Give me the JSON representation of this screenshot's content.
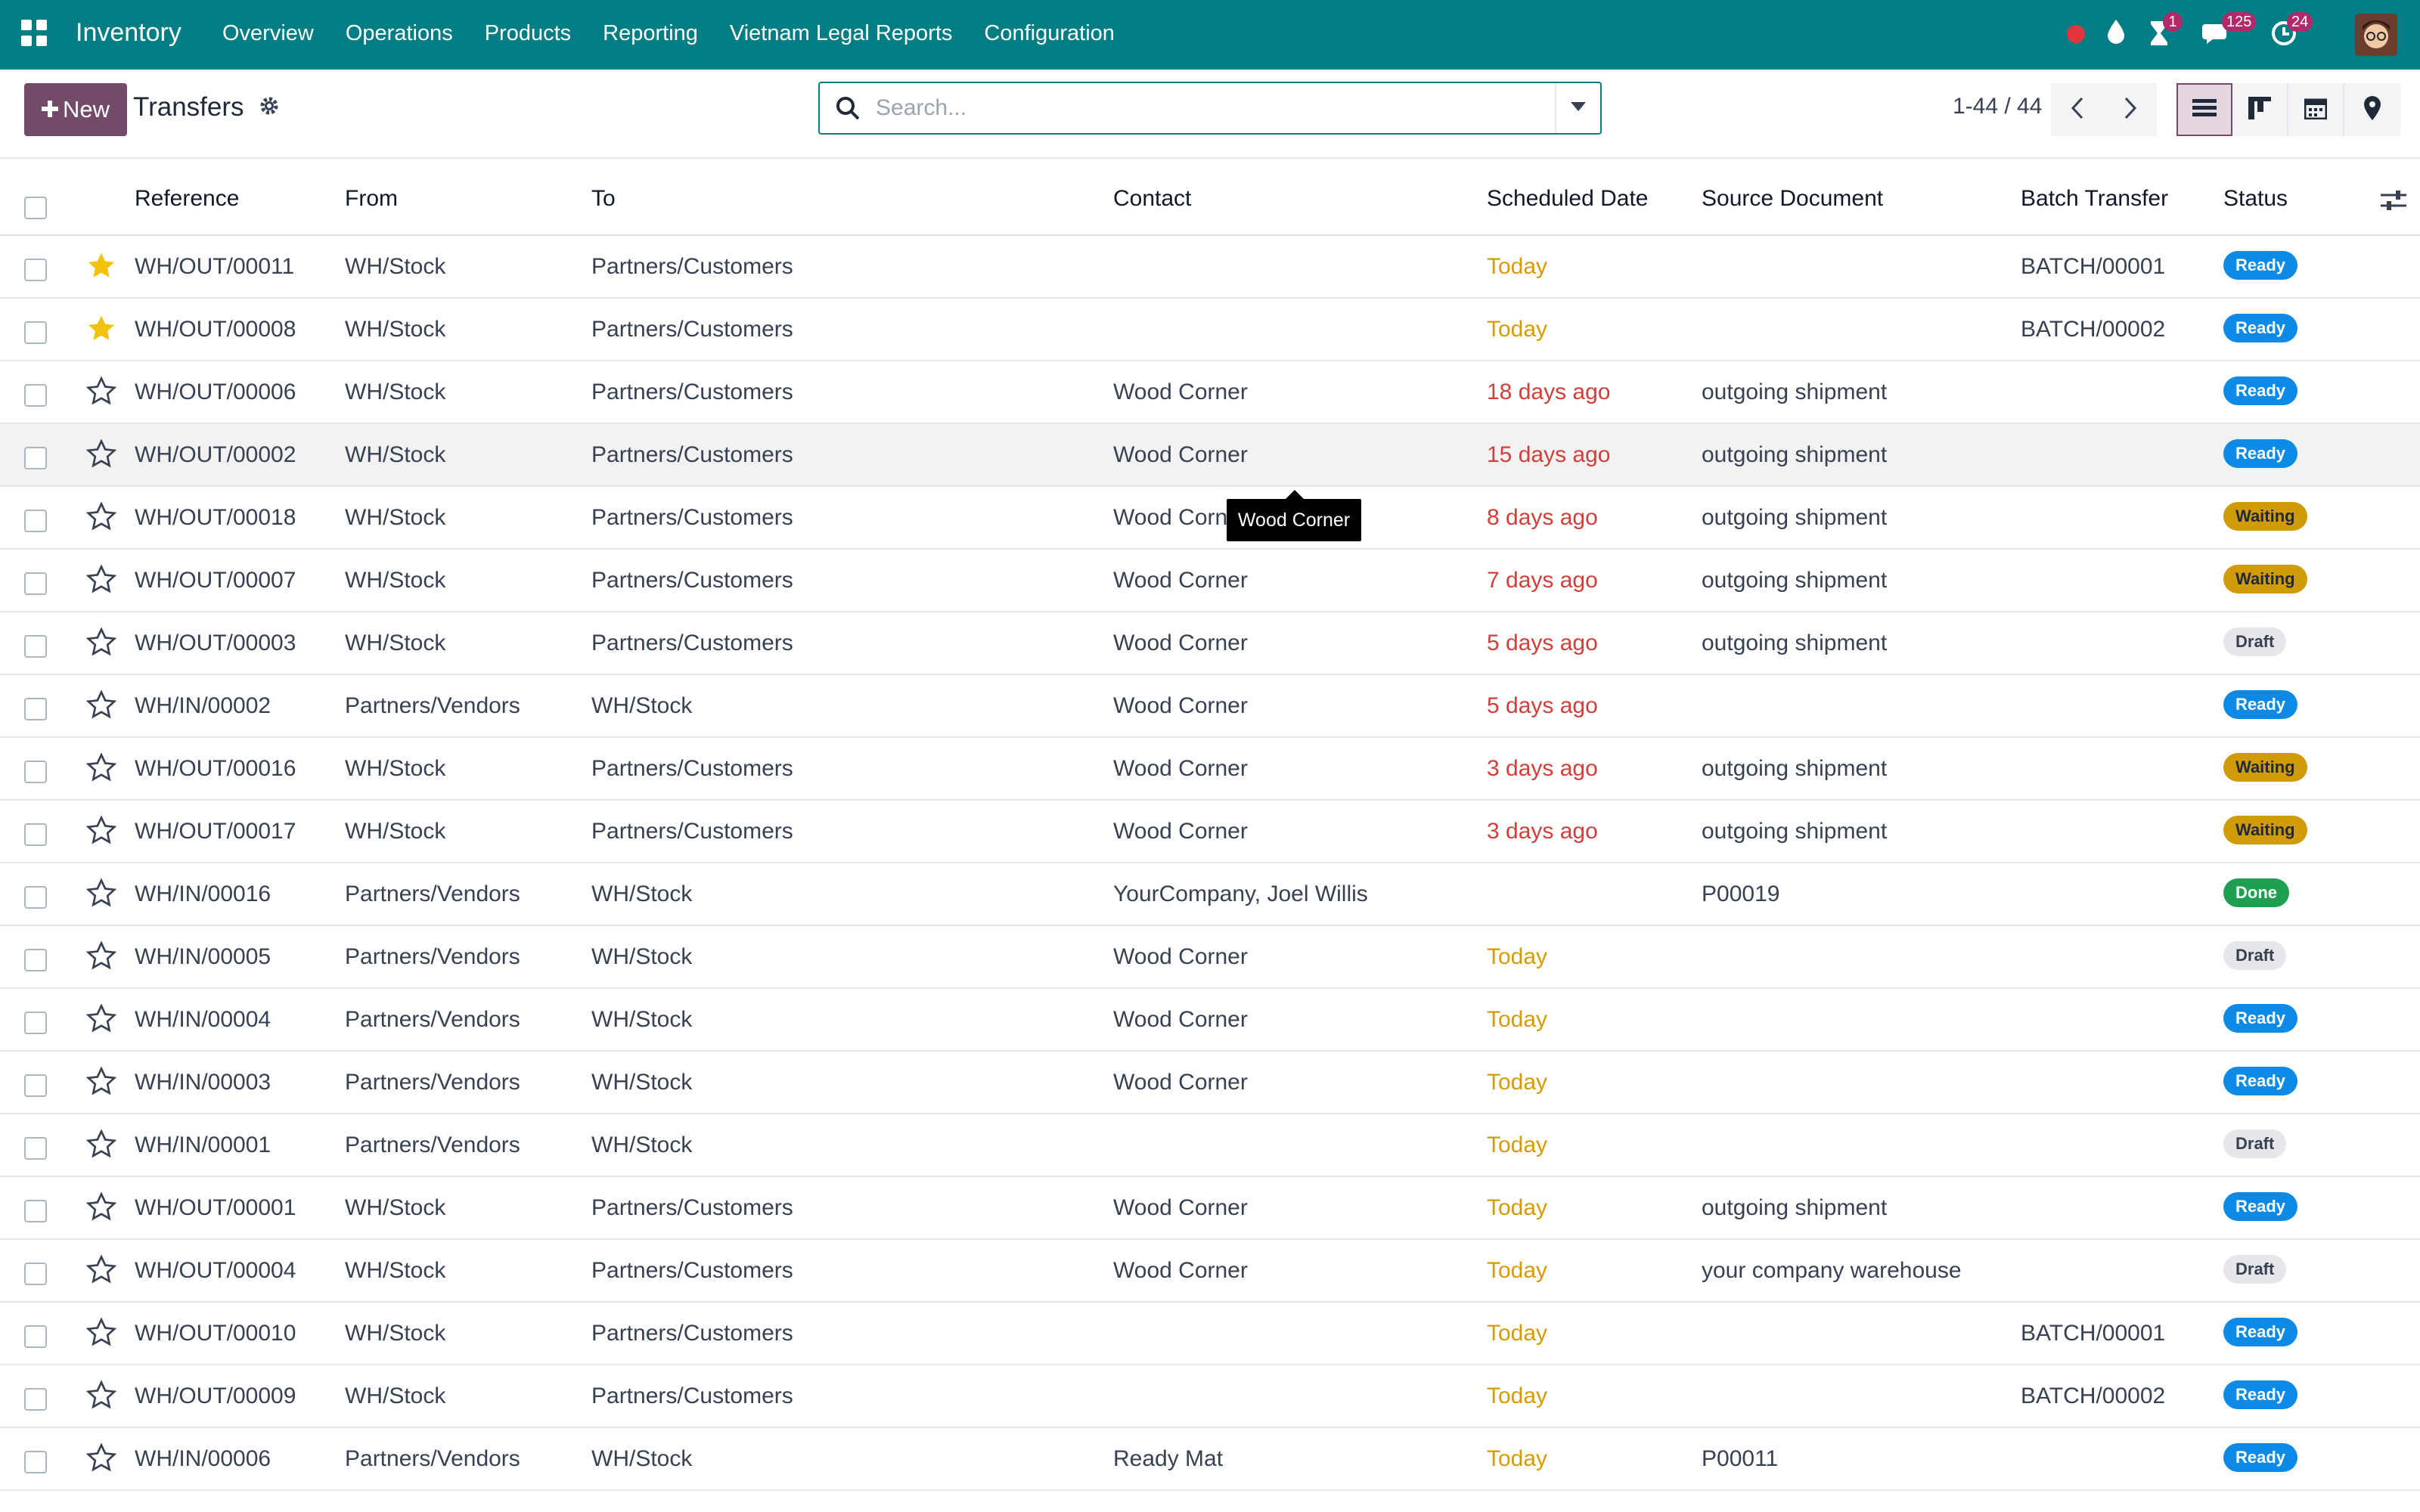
{
  "app": {
    "title": "Inventory",
    "menu": [
      "Overview",
      "Operations",
      "Products",
      "Reporting",
      "Vietnam Legal Reports",
      "Configuration"
    ],
    "systray": {
      "activity_count": "1",
      "messages_count": "125",
      "updates_count": "24"
    }
  },
  "control_panel": {
    "new_label": "New",
    "breadcrumb": "Transfers",
    "search_placeholder": "Search...",
    "pager": "1-44 / 44"
  },
  "table": {
    "columns": [
      "Reference",
      "From",
      "To",
      "Contact",
      "Scheduled Date",
      "Source Document",
      "Batch Transfer",
      "Status"
    ],
    "rows": [
      {
        "ref": "WH/OUT/00011",
        "starred": true,
        "from": "WH/Stock",
        "to": "Partners/Customers",
        "contact": "",
        "date": "Today",
        "date_state": "today",
        "source": "",
        "batch": "BATCH/00001",
        "status": "Ready"
      },
      {
        "ref": "WH/OUT/00008",
        "starred": true,
        "from": "WH/Stock",
        "to": "Partners/Customers",
        "contact": "",
        "date": "Today",
        "date_state": "today",
        "source": "",
        "batch": "BATCH/00002",
        "status": "Ready"
      },
      {
        "ref": "WH/OUT/00006",
        "starred": false,
        "from": "WH/Stock",
        "to": "Partners/Customers",
        "contact": "Wood Corner",
        "date": "18 days ago",
        "date_state": "late",
        "source": "outgoing shipment",
        "batch": "",
        "status": "Ready"
      },
      {
        "ref": "WH/OUT/00002",
        "starred": false,
        "from": "WH/Stock",
        "to": "Partners/Customers",
        "contact": "Wood Corner",
        "date": "15 days ago",
        "date_state": "late",
        "source": "outgoing shipment",
        "batch": "",
        "status": "Ready"
      },
      {
        "ref": "WH/OUT/00018",
        "starred": false,
        "from": "WH/Stock",
        "to": "Partners/Customers",
        "contact": "Wood Corn",
        "date": "8 days ago",
        "date_state": "late",
        "source": "outgoing shipment",
        "batch": "",
        "status": "Waiting"
      },
      {
        "ref": "WH/OUT/00007",
        "starred": false,
        "from": "WH/Stock",
        "to": "Partners/Customers",
        "contact": "Wood Corner",
        "date": "7 days ago",
        "date_state": "late",
        "source": "outgoing shipment",
        "batch": "",
        "status": "Waiting"
      },
      {
        "ref": "WH/OUT/00003",
        "starred": false,
        "from": "WH/Stock",
        "to": "Partners/Customers",
        "contact": "Wood Corner",
        "date": "5 days ago",
        "date_state": "late",
        "source": "outgoing shipment",
        "batch": "",
        "status": "Draft"
      },
      {
        "ref": "WH/IN/00002",
        "starred": false,
        "from": "Partners/Vendors",
        "to": "WH/Stock",
        "contact": "Wood Corner",
        "date": "5 days ago",
        "date_state": "late",
        "source": "",
        "batch": "",
        "status": "Ready"
      },
      {
        "ref": "WH/OUT/00016",
        "starred": false,
        "from": "WH/Stock",
        "to": "Partners/Customers",
        "contact": "Wood Corner",
        "date": "3 days ago",
        "date_state": "late",
        "source": "outgoing shipment",
        "batch": "",
        "status": "Waiting"
      },
      {
        "ref": "WH/OUT/00017",
        "starred": false,
        "from": "WH/Stock",
        "to": "Partners/Customers",
        "contact": "Wood Corner",
        "date": "3 days ago",
        "date_state": "late",
        "source": "outgoing shipment",
        "batch": "",
        "status": "Waiting"
      },
      {
        "ref": "WH/IN/00016",
        "starred": false,
        "from": "Partners/Vendors",
        "to": "WH/Stock",
        "contact": "YourCompany, Joel Willis",
        "date": "",
        "date_state": "none",
        "source": "P00019",
        "batch": "",
        "status": "Done"
      },
      {
        "ref": "WH/IN/00005",
        "starred": false,
        "from": "Partners/Vendors",
        "to": "WH/Stock",
        "contact": "Wood Corner",
        "date": "Today",
        "date_state": "today",
        "source": "",
        "batch": "",
        "status": "Draft"
      },
      {
        "ref": "WH/IN/00004",
        "starred": false,
        "from": "Partners/Vendors",
        "to": "WH/Stock",
        "contact": "Wood Corner",
        "date": "Today",
        "date_state": "today",
        "source": "",
        "batch": "",
        "status": "Ready"
      },
      {
        "ref": "WH/IN/00003",
        "starred": false,
        "from": "Partners/Vendors",
        "to": "WH/Stock",
        "contact": "Wood Corner",
        "date": "Today",
        "date_state": "today",
        "source": "",
        "batch": "",
        "status": "Ready"
      },
      {
        "ref": "WH/IN/00001",
        "starred": false,
        "from": "Partners/Vendors",
        "to": "WH/Stock",
        "contact": "",
        "date": "Today",
        "date_state": "today",
        "source": "",
        "batch": "",
        "status": "Draft"
      },
      {
        "ref": "WH/OUT/00001",
        "starred": false,
        "from": "WH/Stock",
        "to": "Partners/Customers",
        "contact": "Wood Corner",
        "date": "Today",
        "date_state": "today",
        "source": "outgoing shipment",
        "batch": "",
        "status": "Ready"
      },
      {
        "ref": "WH/OUT/00004",
        "starred": false,
        "from": "WH/Stock",
        "to": "Partners/Customers",
        "contact": "Wood Corner",
        "date": "Today",
        "date_state": "today",
        "source": "your company warehouse",
        "batch": "",
        "status": "Draft"
      },
      {
        "ref": "WH/OUT/00010",
        "starred": false,
        "from": "WH/Stock",
        "to": "Partners/Customers",
        "contact": "",
        "date": "Today",
        "date_state": "today",
        "source": "",
        "batch": "BATCH/00001",
        "status": "Ready"
      },
      {
        "ref": "WH/OUT/00009",
        "starred": false,
        "from": "WH/Stock",
        "to": "Partners/Customers",
        "contact": "",
        "date": "Today",
        "date_state": "today",
        "source": "",
        "batch": "BATCH/00002",
        "status": "Ready"
      },
      {
        "ref": "WH/IN/00006",
        "starred": false,
        "from": "Partners/Vendors",
        "to": "WH/Stock",
        "contact": "Ready Mat",
        "date": "Today",
        "date_state": "today",
        "source": "P00011",
        "batch": "",
        "status": "Ready"
      }
    ]
  },
  "tooltip": {
    "text": "Wood Corner"
  },
  "colors": {
    "brand_teal": "#017e84",
    "primary_purple": "#714b67",
    "ready": "#0d8ae5",
    "waiting": "#d19a07",
    "done": "#1e9f52",
    "late": "#d23f3a",
    "today": "#d69b00"
  }
}
